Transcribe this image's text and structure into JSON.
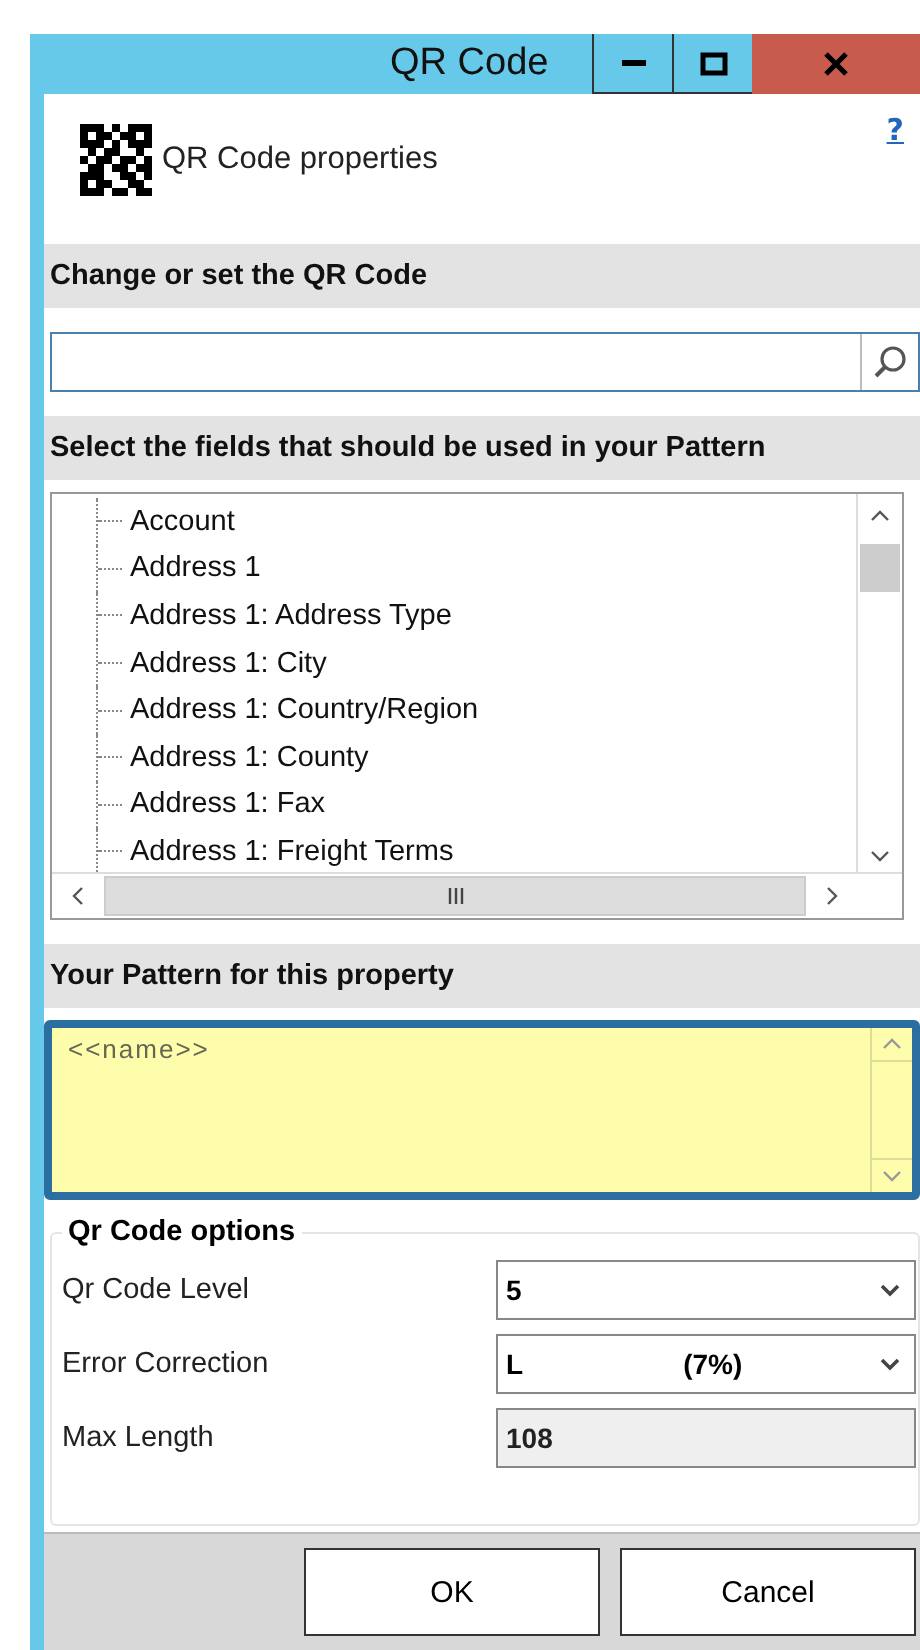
{
  "window": {
    "title": "QR Code"
  },
  "header": {
    "title": "QR Code properties",
    "help": "?"
  },
  "code_section": {
    "heading": "Change or set the QR Code"
  },
  "fields_section": {
    "heading": "Select the fields that should be used in your Pattern",
    "items": [
      {
        "label": "Account"
      },
      {
        "label": "Address 1"
      },
      {
        "label": "Address 1: Address Type"
      },
      {
        "label": "Address 1: City"
      },
      {
        "label": "Address 1: Country/Region"
      },
      {
        "label": "Address 1: County"
      },
      {
        "label": "Address 1: Fax"
      },
      {
        "label": "Address 1: Freight Terms"
      }
    ]
  },
  "pattern_section": {
    "heading": "Your Pattern for this property",
    "value": "<<name>>"
  },
  "options": {
    "title": "Qr Code options",
    "rows": [
      {
        "kind": "dropdown",
        "label": "Qr Code Level",
        "value": "5",
        "disabled": false
      },
      {
        "kind": "dropdown",
        "label": "Error Correction",
        "value": "L",
        "value_2": "(7%)",
        "disabled": false
      },
      {
        "kind": "field",
        "label": "Max Length",
        "value": "108",
        "disabled": true
      }
    ]
  },
  "buttons": [
    "OK",
    "Cancel"
  ]
}
